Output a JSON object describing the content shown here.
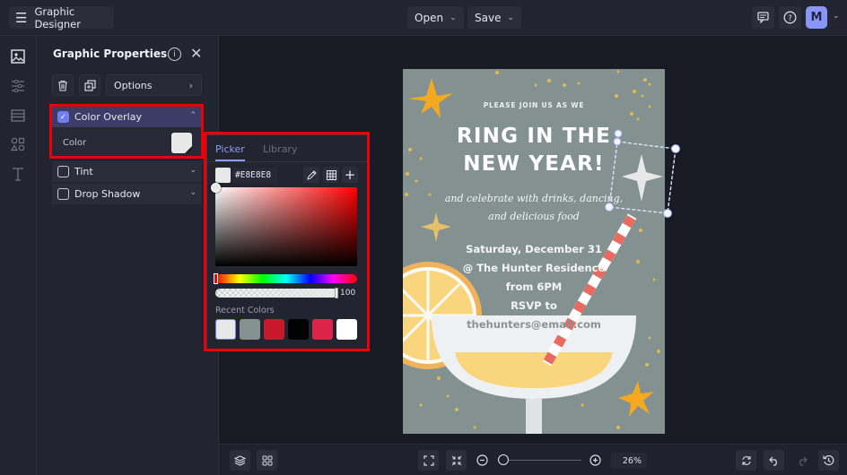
{
  "topbar": {
    "app_title": "Graphic Designer",
    "open_label": "Open",
    "save_label": "Save",
    "avatar_initial": "M"
  },
  "panel": {
    "title": "Graphic Properties",
    "options_label": "Options",
    "sections": [
      {
        "label": "Color Overlay",
        "checked": true,
        "expanded": true
      },
      {
        "label": "Tint",
        "checked": false
      },
      {
        "label": "Drop Shadow",
        "checked": false
      }
    ],
    "color_label": "Color",
    "color_value": "#E8E8E8"
  },
  "picker": {
    "tabs": [
      "Picker",
      "Library"
    ],
    "active_tab": "Picker",
    "hex": "#E8E8E8",
    "opacity": "100",
    "recent_label": "Recent Colors",
    "recent_colors": [
      "#E8E8E8",
      "#839190",
      "#C8182B",
      "#020202",
      "#DB2448",
      "#FFFFFF"
    ],
    "hue_color": "#FF0000"
  },
  "design": {
    "line1": "PLEASE JOIN US AS WE",
    "title1": "RING IN THE",
    "title2": "NEW YEAR!",
    "script1": "and celebrate with drinks, dancing,",
    "script2": "and delicious food",
    "date": "Saturday, December 31",
    "place": "@ The Hunter Residence",
    "time": "from 6PM",
    "rsvp": "RSVP to",
    "email": "thehunters@email.com",
    "bg_color": "#839190",
    "accent": "#F5B02E",
    "drink": "#F9D57D"
  },
  "bottombar": {
    "zoom": "26%",
    "zoom_fraction": 0.05
  }
}
